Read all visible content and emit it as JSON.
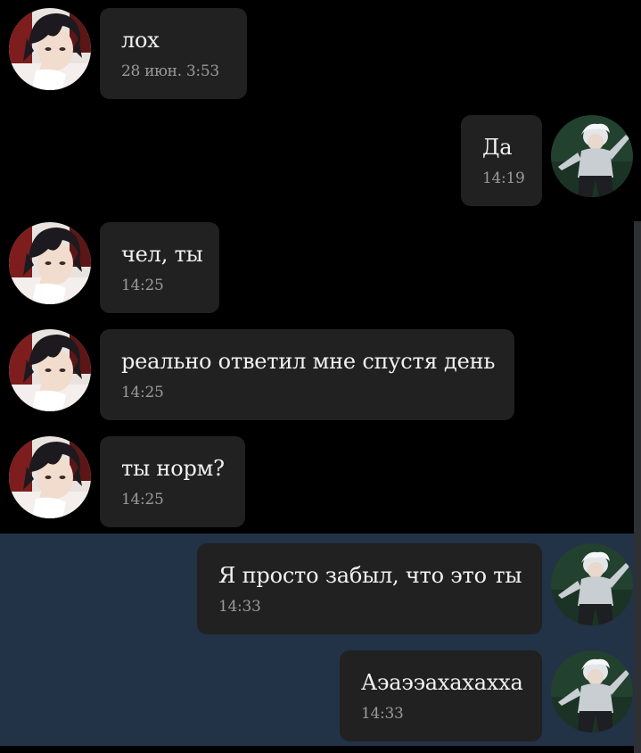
{
  "chat": {
    "messages": [
      {
        "side": "left",
        "text": "лох",
        "time": "28 июн. 3:53"
      },
      {
        "side": "right",
        "text": "Да",
        "time": "14:19"
      },
      {
        "side": "left",
        "text": "чел, ты",
        "time": "14:25"
      },
      {
        "side": "left",
        "text": "реально ответил мне спустя день",
        "time": "14:25"
      },
      {
        "side": "left",
        "text": "ты норм?",
        "time": "14:25"
      },
      {
        "side": "right",
        "text": "Я просто забыл, что это ты",
        "time": "14:33"
      },
      {
        "side": "right",
        "text": "Аэаээахахахха",
        "time": "14:33"
      }
    ]
  },
  "colors": {
    "background": "#000000",
    "bubble": "#212121",
    "highlight": "#223247",
    "message_text": "#f2f2f2",
    "time_text": "#9a9a9a"
  },
  "icons": {
    "left_avatar": "anime-dark-hair-avatar",
    "right_avatar": "anime-white-hair-avatar"
  }
}
